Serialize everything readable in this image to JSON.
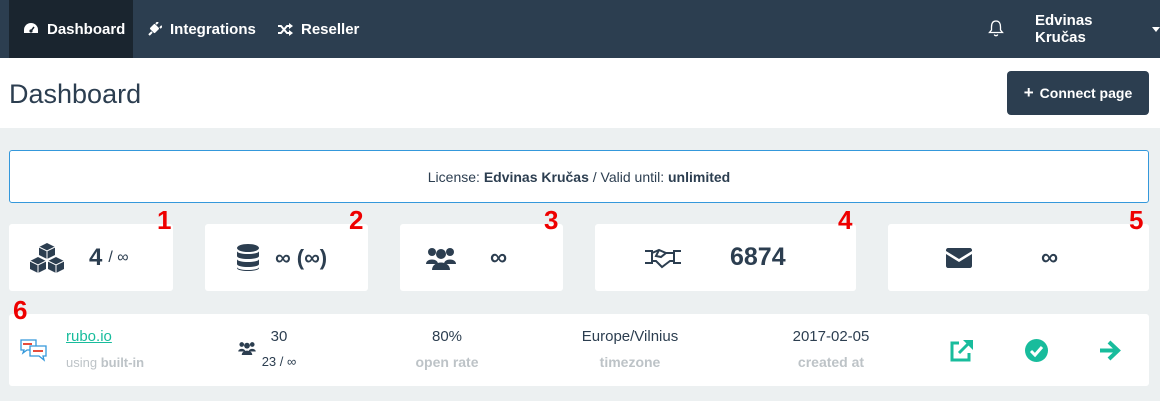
{
  "nav": {
    "items": [
      {
        "label": "Dashboard",
        "icon": "dashboard-icon"
      },
      {
        "label": "Integrations",
        "icon": "plug-icon"
      },
      {
        "label": "Reseller",
        "icon": "random-icon"
      }
    ],
    "user": "Edvinas Kručas"
  },
  "header": {
    "title": "Dashboard",
    "connect_label": "Connect page"
  },
  "license": {
    "prefix": "License:",
    "owner": "Edvinas Kručas",
    "middle": "/ Valid until:",
    "valid": "unlimited"
  },
  "stats": {
    "pages": {
      "used": "4",
      "limit": "/ ∞"
    },
    "storage": "∞ (∞)",
    "subscribers": "∞",
    "deals": "6874",
    "messages": "∞"
  },
  "markers": [
    "1",
    "2",
    "3",
    "4",
    "5",
    "6"
  ],
  "page_row": {
    "name": "rubo.io",
    "using": "using",
    "engine": "built-in",
    "subscribers": "30",
    "subscribers_sub": "23 / ∞",
    "open_rate": "80%",
    "open_rate_label": "open rate",
    "timezone": "Europe/Vilnius",
    "timezone_label": "timezone",
    "created": "2017-02-05",
    "created_label": "created at"
  },
  "colors": {
    "navbar": "#2c3e50",
    "active": "#1a252f",
    "accent": "#18bc9c",
    "license_border": "#3498db",
    "marker": "#e00000"
  }
}
